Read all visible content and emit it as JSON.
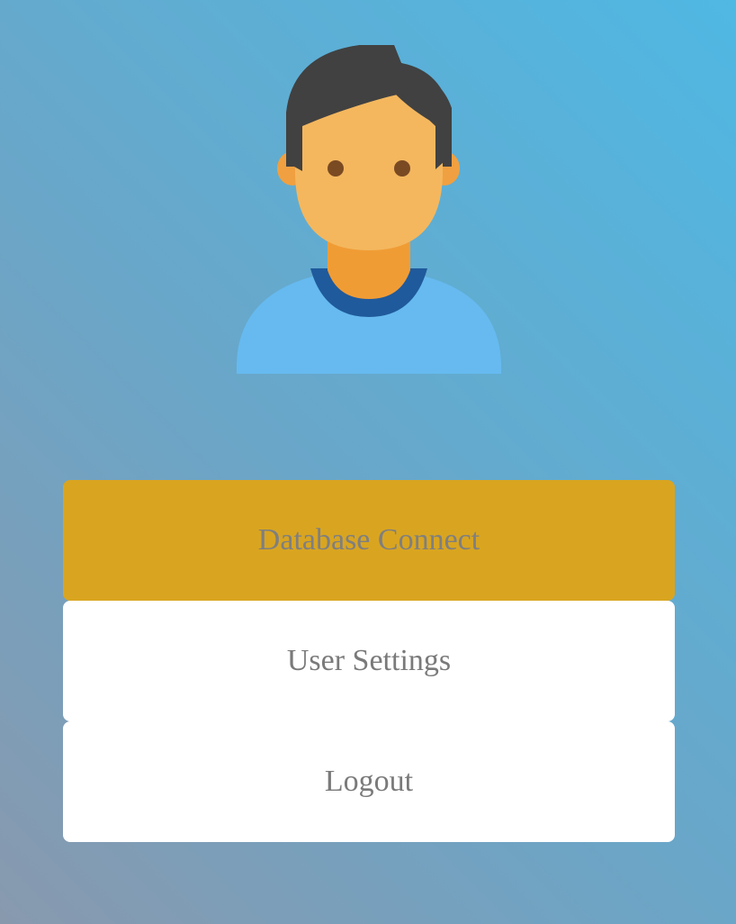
{
  "avatar": {
    "icon": "user-avatar-icon",
    "colors": {
      "hair": "#414141",
      "skin": "#f4b75e",
      "neck": "#f09c35",
      "shirt": "#66baf0",
      "collar": "#1f5a9c",
      "eyes": "#7a4a23"
    }
  },
  "menu": {
    "items": [
      {
        "label": "Database Connect",
        "active": true
      },
      {
        "label": "User Settings",
        "active": false
      },
      {
        "label": "Logout",
        "active": false
      }
    ]
  },
  "colors": {
    "active_button": "#d9a520",
    "button": "#ffffff",
    "button_text": "#7a7a7a"
  }
}
